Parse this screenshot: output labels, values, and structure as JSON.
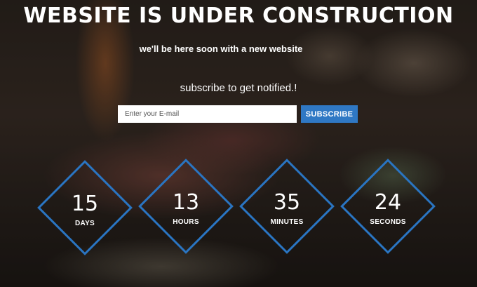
{
  "headline": "WEBSITE IS UNDER CONSTRUCTION",
  "tagline": "we'll be here soon with a new website",
  "subscribe": {
    "prompt": "subscribe to get notified.!",
    "email_placeholder": "Enter your E-mail",
    "email_value": "",
    "button_label": "SUBSCRIBE"
  },
  "countdown": [
    {
      "value": "15",
      "label": "DAYS"
    },
    {
      "value": "13",
      "label": "HOURS"
    },
    {
      "value": "35",
      "label": "MINUTES"
    },
    {
      "value": "24",
      "label": "SECONDS"
    }
  ],
  "colors": {
    "accent": "#2f78c4",
    "diamond_border": "#2a75c2",
    "text": "#ffffff"
  }
}
